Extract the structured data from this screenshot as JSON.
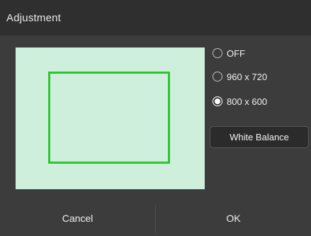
{
  "dialog": {
    "title": "Adjustment"
  },
  "options": [
    {
      "label": "OFF",
      "selected": false
    },
    {
      "label": "960 x 720",
      "selected": false
    },
    {
      "label": "800 x 600",
      "selected": true
    }
  ],
  "white_balance_label": "White Balance",
  "footer": {
    "cancel_label": "Cancel",
    "ok_label": "OK"
  },
  "colors": {
    "preview_background": "#cdefdc",
    "crop_border": "#2ec52e"
  }
}
